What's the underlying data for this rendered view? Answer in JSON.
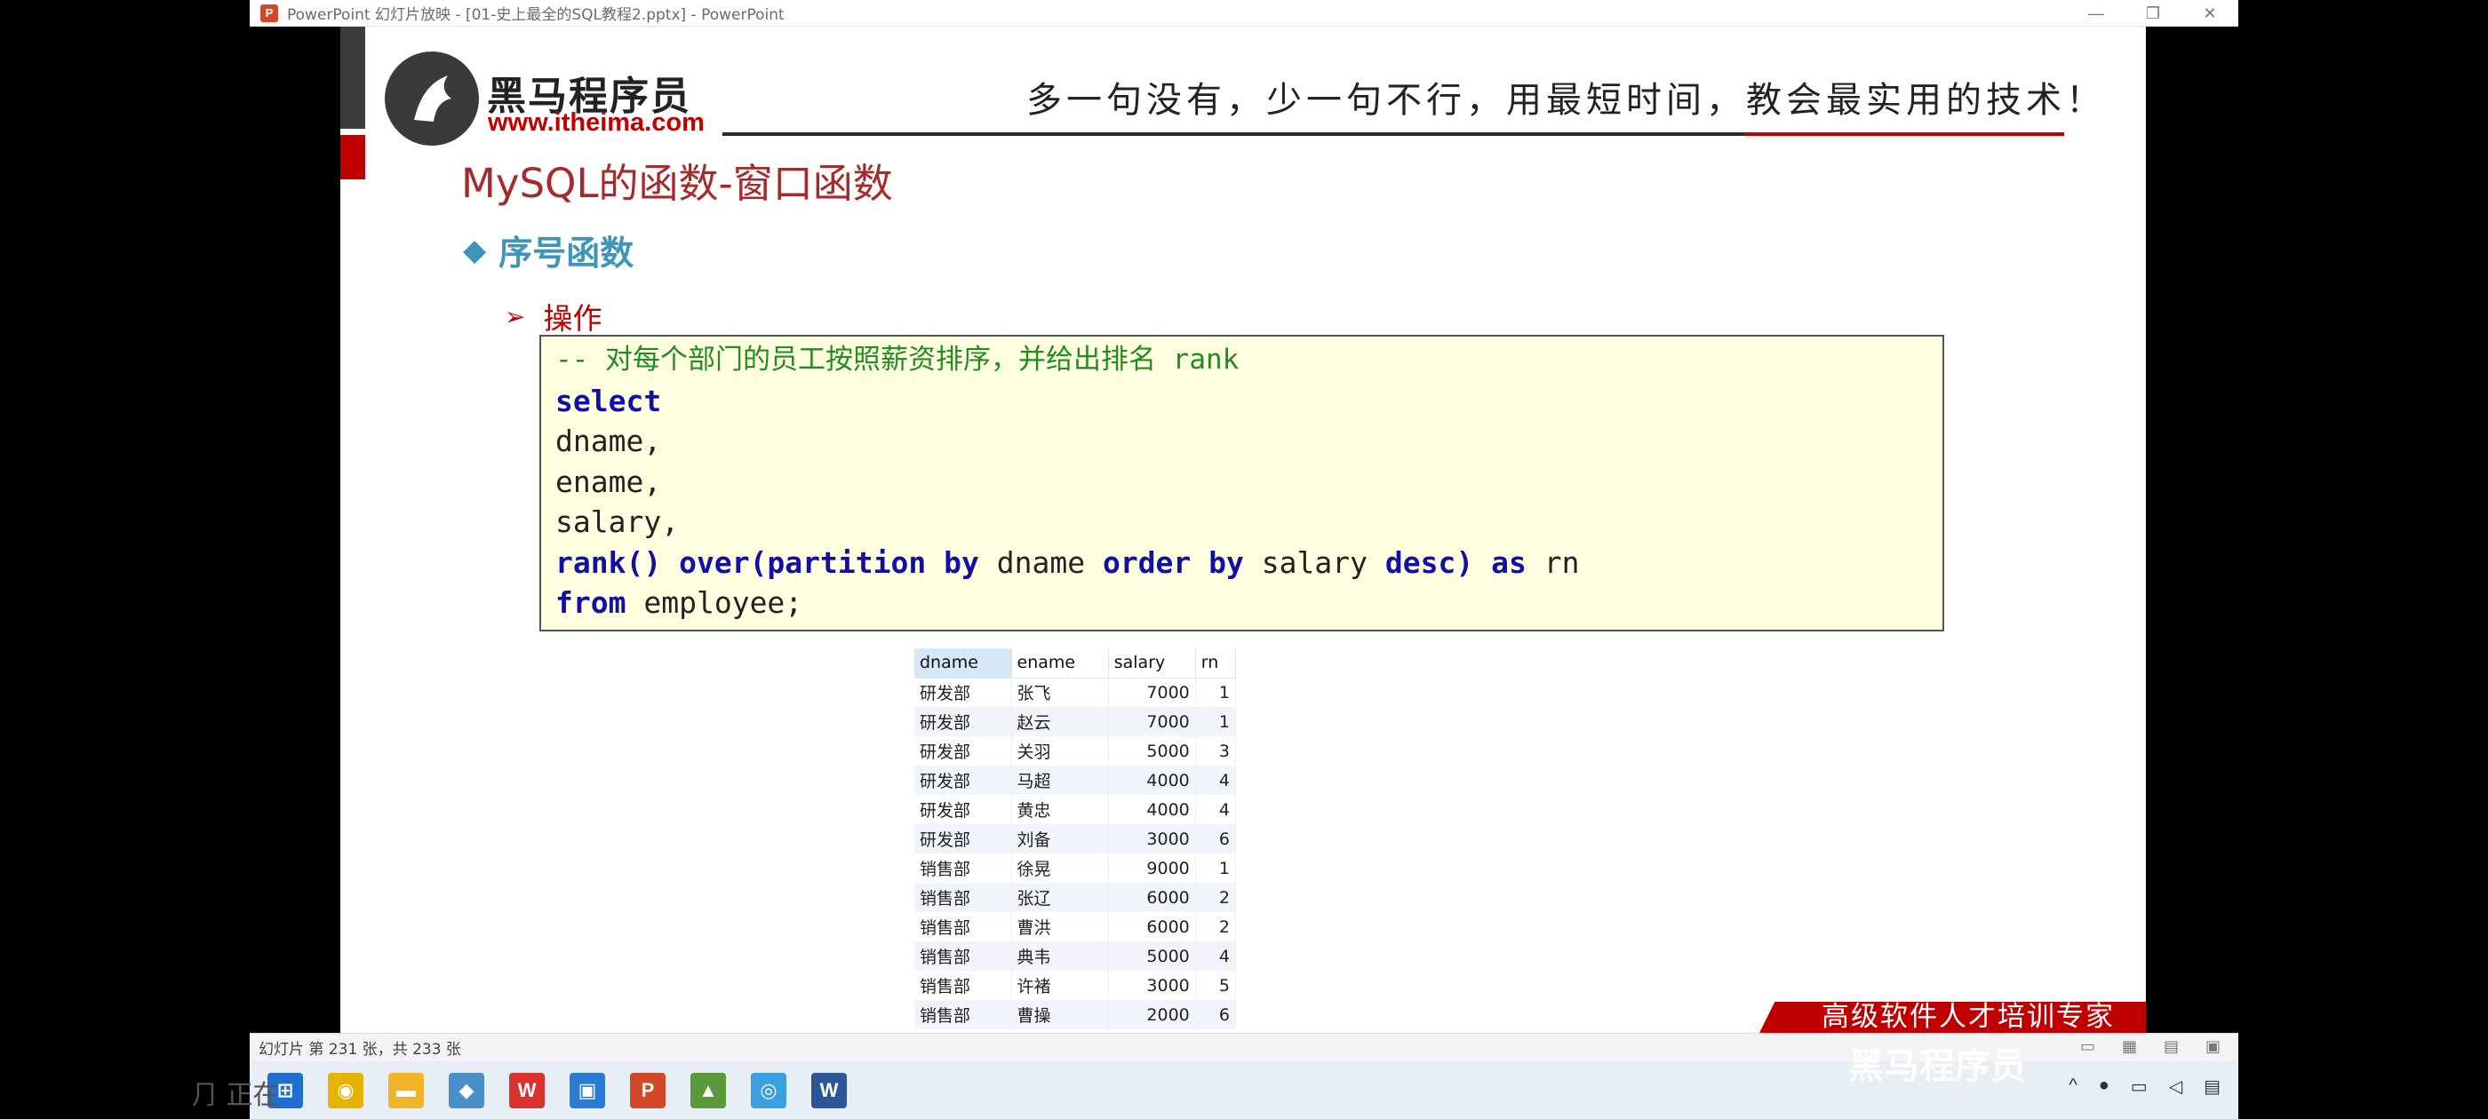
{
  "window": {
    "title": "PowerPoint 幻灯片放映 - [01-史上最全的SQL教程2.pptx] - PowerPoint",
    "app_icon": "P",
    "controls": [
      "—",
      "❐",
      "✕"
    ]
  },
  "slide": {
    "logo_cn": "黑马程序员",
    "logo_url": "www.itheima.com",
    "slogan": "多一句没有，少一句不行，用最短时间，教会最实用的技术！",
    "title": "MySQL的函数-窗口函数",
    "bullet1": "序号函数",
    "bullet2": "操作",
    "code": {
      "comment": "-- 对每个部门的员工按照薪资排序，并给出排名 rank",
      "kw_select": "select",
      "line_dname": "dname,",
      "line_ename": "ename,",
      "line_salary": "salary,",
      "kw_rank": "rank()",
      "kw_over": "over(partition by",
      "t_dname": "dname",
      "kw_order": "order by",
      "t_salary": "salary",
      "kw_desc": "desc)",
      "kw_as": "as",
      "t_rn": "rn",
      "kw_from": "from",
      "t_employee": "employee;"
    },
    "result_table": {
      "columns": [
        "dname",
        "ename",
        "salary",
        "rn"
      ],
      "rows": [
        [
          "研发部",
          "张飞",
          "7000",
          "1"
        ],
        [
          "研发部",
          "赵云",
          "7000",
          "1"
        ],
        [
          "研发部",
          "关羽",
          "5000",
          "3"
        ],
        [
          "研发部",
          "马超",
          "4000",
          "4"
        ],
        [
          "研发部",
          "黄忠",
          "4000",
          "4"
        ],
        [
          "研发部",
          "刘备",
          "3000",
          "6"
        ],
        [
          "销售部",
          "徐晃",
          "9000",
          "1"
        ],
        [
          "销售部",
          "张辽",
          "6000",
          "2"
        ],
        [
          "销售部",
          "曹洪",
          "6000",
          "2"
        ],
        [
          "销售部",
          "典韦",
          "5000",
          "4"
        ],
        [
          "销售部",
          "许褚",
          "3000",
          "5"
        ],
        [
          "销售部",
          "曹操",
          "2000",
          "6"
        ]
      ]
    },
    "banner": "高级软件人才培训专家"
  },
  "statusbar": {
    "status": "幻灯片 第 231 张，共 233 张"
  },
  "watermark": "黑马程序员",
  "side_text": "⺆ 正在"
}
